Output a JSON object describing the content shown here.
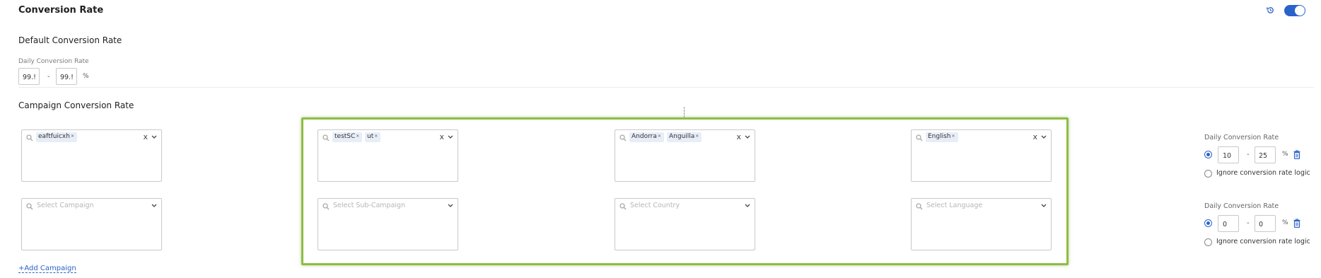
{
  "section": {
    "title": "Conversion Rate",
    "enabled": true,
    "history_icon": "history-icon"
  },
  "default_rate": {
    "heading": "Default Conversion Rate",
    "label": "Daily Conversion Rate",
    "min": "99.!",
    "max": "99.!",
    "separator": "-",
    "unit": "%"
  },
  "campaign_rate": {
    "heading": "Campaign Conversion Rate",
    "add_label": "+Add Campaign",
    "rows": [
      {
        "campaign": {
          "tags": [
            "eaftfuicxh"
          ],
          "placeholder": ""
        },
        "sub_campaign": {
          "tags": [
            "testSC",
            "ut"
          ],
          "placeholder": ""
        },
        "country": {
          "tags": [
            "Andorra",
            "Anguilla"
          ],
          "placeholder": ""
        },
        "language": {
          "tags": [
            "English"
          ],
          "placeholder": ""
        },
        "rate_label": "Daily Conversion Rate",
        "min": "10",
        "max": "25",
        "separator": "-",
        "unit": "%",
        "ignore_label": "Ignore conversion rate logic",
        "mode": "rate"
      },
      {
        "campaign": {
          "tags": [],
          "placeholder": "Select Campaign"
        },
        "sub_campaign": {
          "tags": [],
          "placeholder": "Select Sub-Campaign"
        },
        "country": {
          "tags": [],
          "placeholder": "Select Country"
        },
        "language": {
          "tags": [],
          "placeholder": "Select Language"
        },
        "rate_label": "Daily Conversion Rate",
        "min": "0",
        "max": "0",
        "separator": "-",
        "unit": "%",
        "ignore_label": "Ignore conversion rate logic",
        "mode": "rate"
      }
    ]
  },
  "tag_remove_glyph": "×",
  "clear_glyph": "x",
  "colors": {
    "accent": "#2a62c9",
    "highlight": "#8dbd44",
    "tag_bg": "#e8eef8"
  }
}
